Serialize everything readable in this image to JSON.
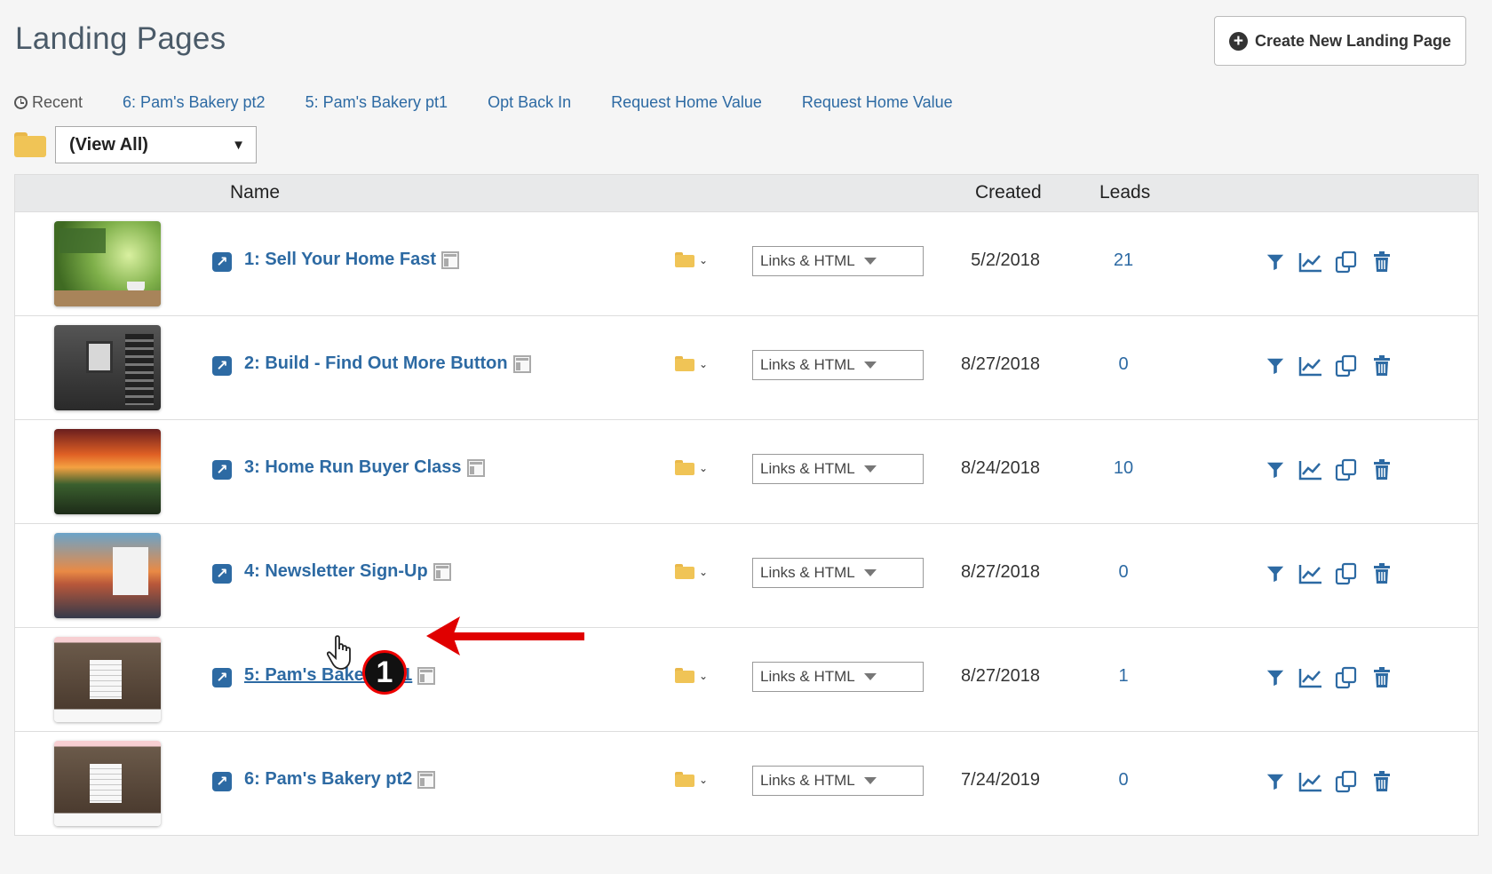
{
  "page": {
    "title": "Landing Pages"
  },
  "create_button": {
    "label": "Create New Landing Page",
    "icon": "plus-circle-icon"
  },
  "recent": {
    "label": "Recent",
    "links": [
      "6: Pam's Bakery pt2",
      "5: Pam's Bakery pt1",
      "Opt Back In",
      "Request Home Value",
      "Request Home Value"
    ]
  },
  "folder_filter": {
    "selected": "(View All)"
  },
  "table": {
    "headers": {
      "name": "Name",
      "created": "Created",
      "leads": "Leads"
    },
    "rows": [
      {
        "name": "1: Sell Your Home Fast",
        "links": "Links & HTML",
        "created": "5/2/2018",
        "leads": "21"
      },
      {
        "name": "2: Build - Find Out More Button",
        "links": "Links & HTML",
        "created": "8/27/2018",
        "leads": "0"
      },
      {
        "name": "3: Home Run Buyer Class",
        "links": "Links & HTML",
        "created": "8/24/2018",
        "leads": "10"
      },
      {
        "name": "4: Newsletter Sign-Up",
        "links": "Links & HTML",
        "created": "8/27/2018",
        "leads": "0"
      },
      {
        "name": "5: Pam's Bakery pt1",
        "links": "Links & HTML",
        "created": "8/27/2018",
        "leads": "1"
      },
      {
        "name": "6: Pam's Bakery pt2",
        "links": "Links & HTML",
        "created": "7/24/2019",
        "leads": "0"
      }
    ]
  },
  "annotation": {
    "step": "1"
  },
  "colors": {
    "link": "#2d6aa3",
    "folder": "#f0c456",
    "annotation_red": "#e00000"
  }
}
